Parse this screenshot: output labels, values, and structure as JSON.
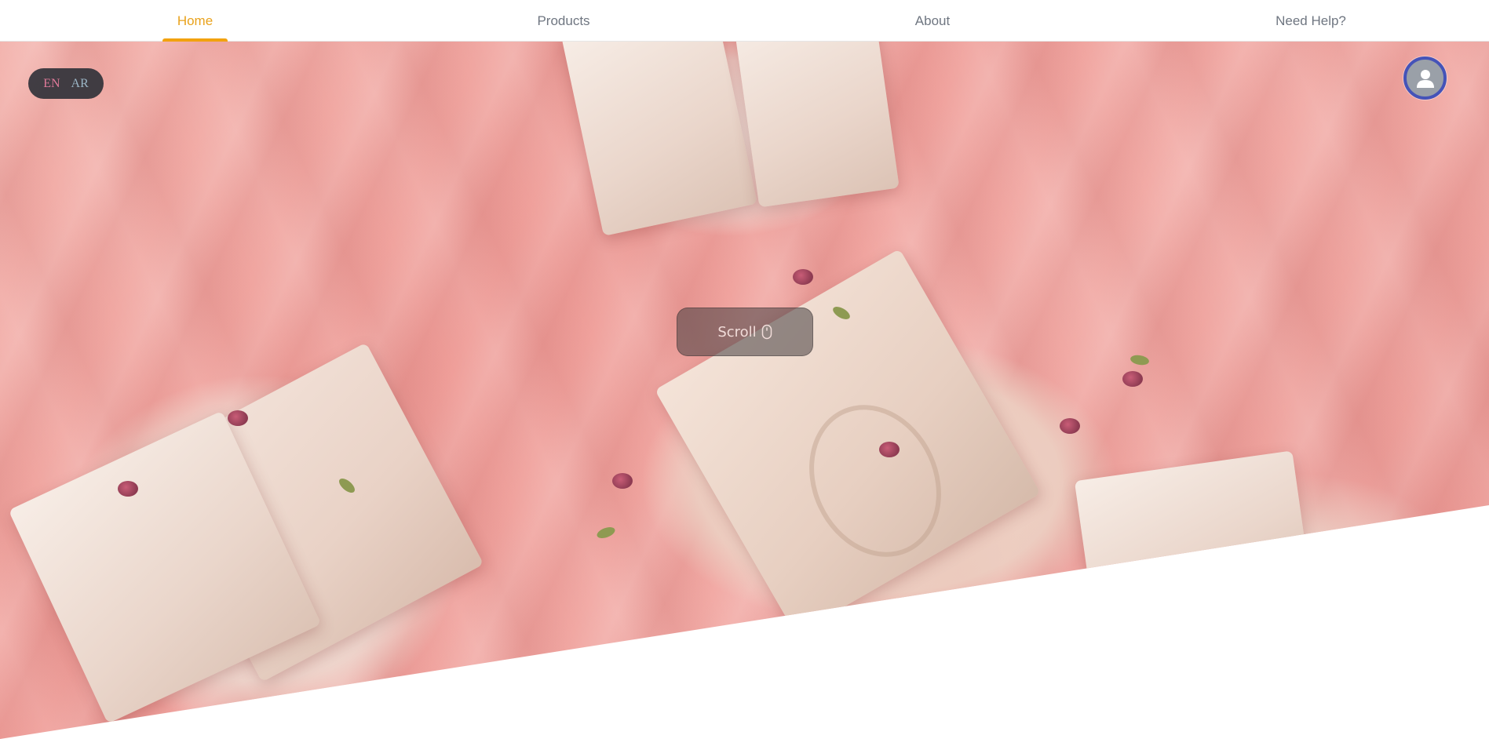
{
  "nav": {
    "items": [
      {
        "label": "Home",
        "active": true
      },
      {
        "label": "Products",
        "active": false
      },
      {
        "label": "About",
        "active": false
      },
      {
        "label": "Need Help?",
        "active": false
      }
    ],
    "active_color": "#e9a21c",
    "text_color": "#6f7681"
  },
  "language": {
    "options": [
      "EN",
      "AR"
    ],
    "selected": "EN"
  },
  "profile": {
    "icon": "user-icon"
  },
  "hero": {
    "scroll_label": "Scroll",
    "scroll_icon": "mouse-icon"
  },
  "colors": {
    "accent": "#f2a20f",
    "profile_ring": "#4553b8",
    "hero_pink": "#ef9e99"
  }
}
